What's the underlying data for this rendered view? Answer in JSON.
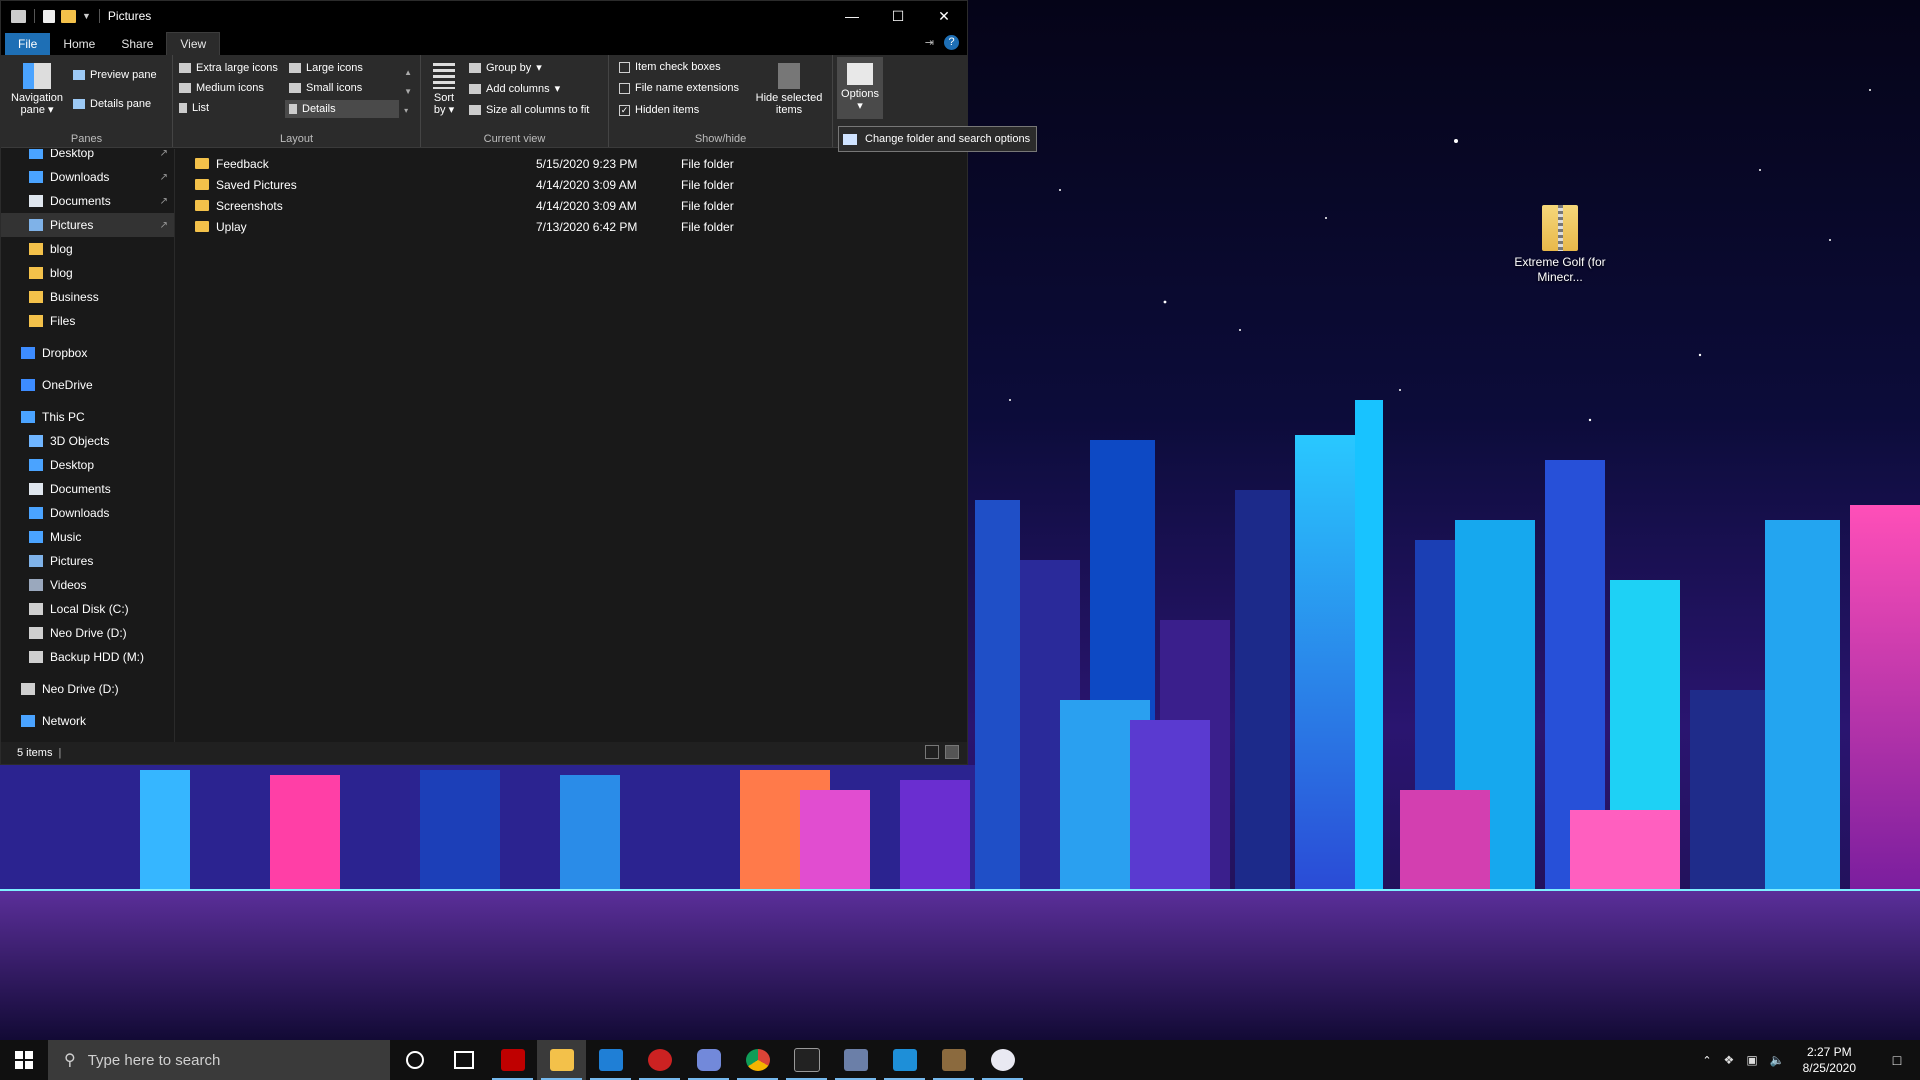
{
  "window": {
    "title": "Pictures",
    "tabs": [
      "File",
      "Home",
      "Share",
      "View"
    ],
    "ribbon": {
      "panes": {
        "name": "Panes",
        "navigation_pane": "Navigation pane",
        "preview_pane": "Preview pane",
        "details_pane": "Details pane"
      },
      "layout": {
        "name": "Layout",
        "items": [
          "Extra large icons",
          "Large icons",
          "Medium icons",
          "Small icons",
          "List",
          "Details"
        ],
        "selected": "Details"
      },
      "current_view": {
        "name": "Current view",
        "sort_by": "Sort by",
        "group_by": "Group by",
        "add_columns": "Add columns",
        "size_columns": "Size all columns to fit"
      },
      "show_hide": {
        "name": "Show/hide",
        "item_check_boxes": {
          "label": "Item check boxes",
          "checked": false
        },
        "file_name_extensions": {
          "label": "File name extensions",
          "checked": false
        },
        "hidden_items": {
          "label": "Hidden items",
          "checked": true
        },
        "hide_selected": "Hide selected items"
      },
      "options": "Options",
      "options_tooltip": "Change folder and search options"
    },
    "nav": {
      "items": [
        {
          "label": "Desktop",
          "icon": "desktop-icon",
          "pinned": true
        },
        {
          "label": "Downloads",
          "icon": "download-icon",
          "pinned": true
        },
        {
          "label": "Documents",
          "icon": "documents-icon",
          "pinned": true
        },
        {
          "label": "Pictures",
          "icon": "pictures-icon",
          "pinned": true,
          "selected": true
        },
        {
          "label": "blog",
          "icon": "folder-icon"
        },
        {
          "label": "blog",
          "icon": "folder-icon"
        },
        {
          "label": "Business",
          "icon": "folder-icon"
        },
        {
          "label": "Files",
          "icon": "folder-icon"
        },
        {
          "label": "Dropbox",
          "icon": "dropbox-icon"
        },
        {
          "label": "OneDrive",
          "icon": "onedrive-icon"
        },
        {
          "label": "This PC",
          "icon": "pc-icon"
        },
        {
          "label": "3D Objects",
          "icon": "cube-icon"
        },
        {
          "label": "Desktop",
          "icon": "desktop-icon"
        },
        {
          "label": "Documents",
          "icon": "documents-icon"
        },
        {
          "label": "Downloads",
          "icon": "download-icon"
        },
        {
          "label": "Music",
          "icon": "music-icon"
        },
        {
          "label": "Pictures",
          "icon": "pictures-icon"
        },
        {
          "label": "Videos",
          "icon": "videos-icon"
        },
        {
          "label": "Local Disk (C:)",
          "icon": "drive-icon"
        },
        {
          "label": "Neo Drive (D:)",
          "icon": "drive-icon"
        },
        {
          "label": "Backup HDD (M:)",
          "icon": "drive-icon"
        },
        {
          "label": "Neo Drive (D:)",
          "icon": "drive-icon"
        },
        {
          "label": "Network",
          "icon": "network-icon"
        }
      ]
    },
    "files": [
      {
        "name": "Feedback",
        "date": "5/15/2020 9:23 PM",
        "type": "File folder"
      },
      {
        "name": "Saved Pictures",
        "date": "4/14/2020 3:09 AM",
        "type": "File folder"
      },
      {
        "name": "Screenshots",
        "date": "4/14/2020 3:09 AM",
        "type": "File folder"
      },
      {
        "name": "Uplay",
        "date": "7/13/2020 6:42 PM",
        "type": "File folder"
      }
    ],
    "status": "5 items"
  },
  "desktop_icon": {
    "label": "Extreme Golf (for Minecr..."
  },
  "taskbar": {
    "search_placeholder": "Type here to search",
    "time": "2:27 PM",
    "date": "8/25/2020",
    "apps": [
      "cortana-icon",
      "task-view-icon",
      "filezilla-icon",
      "file-explorer-icon",
      "mail-icon",
      "pob-icon",
      "discord-icon",
      "chrome-icon",
      "terminal-icon",
      "game-icon",
      "vscode-icon",
      "minecraft-icon",
      "paint-icon"
    ]
  },
  "colors": {
    "accent": "#1e6fb5",
    "folder": "#f3c14a",
    "window_bg": "#191919",
    "ribbon_bg": "#2b2b2b"
  }
}
